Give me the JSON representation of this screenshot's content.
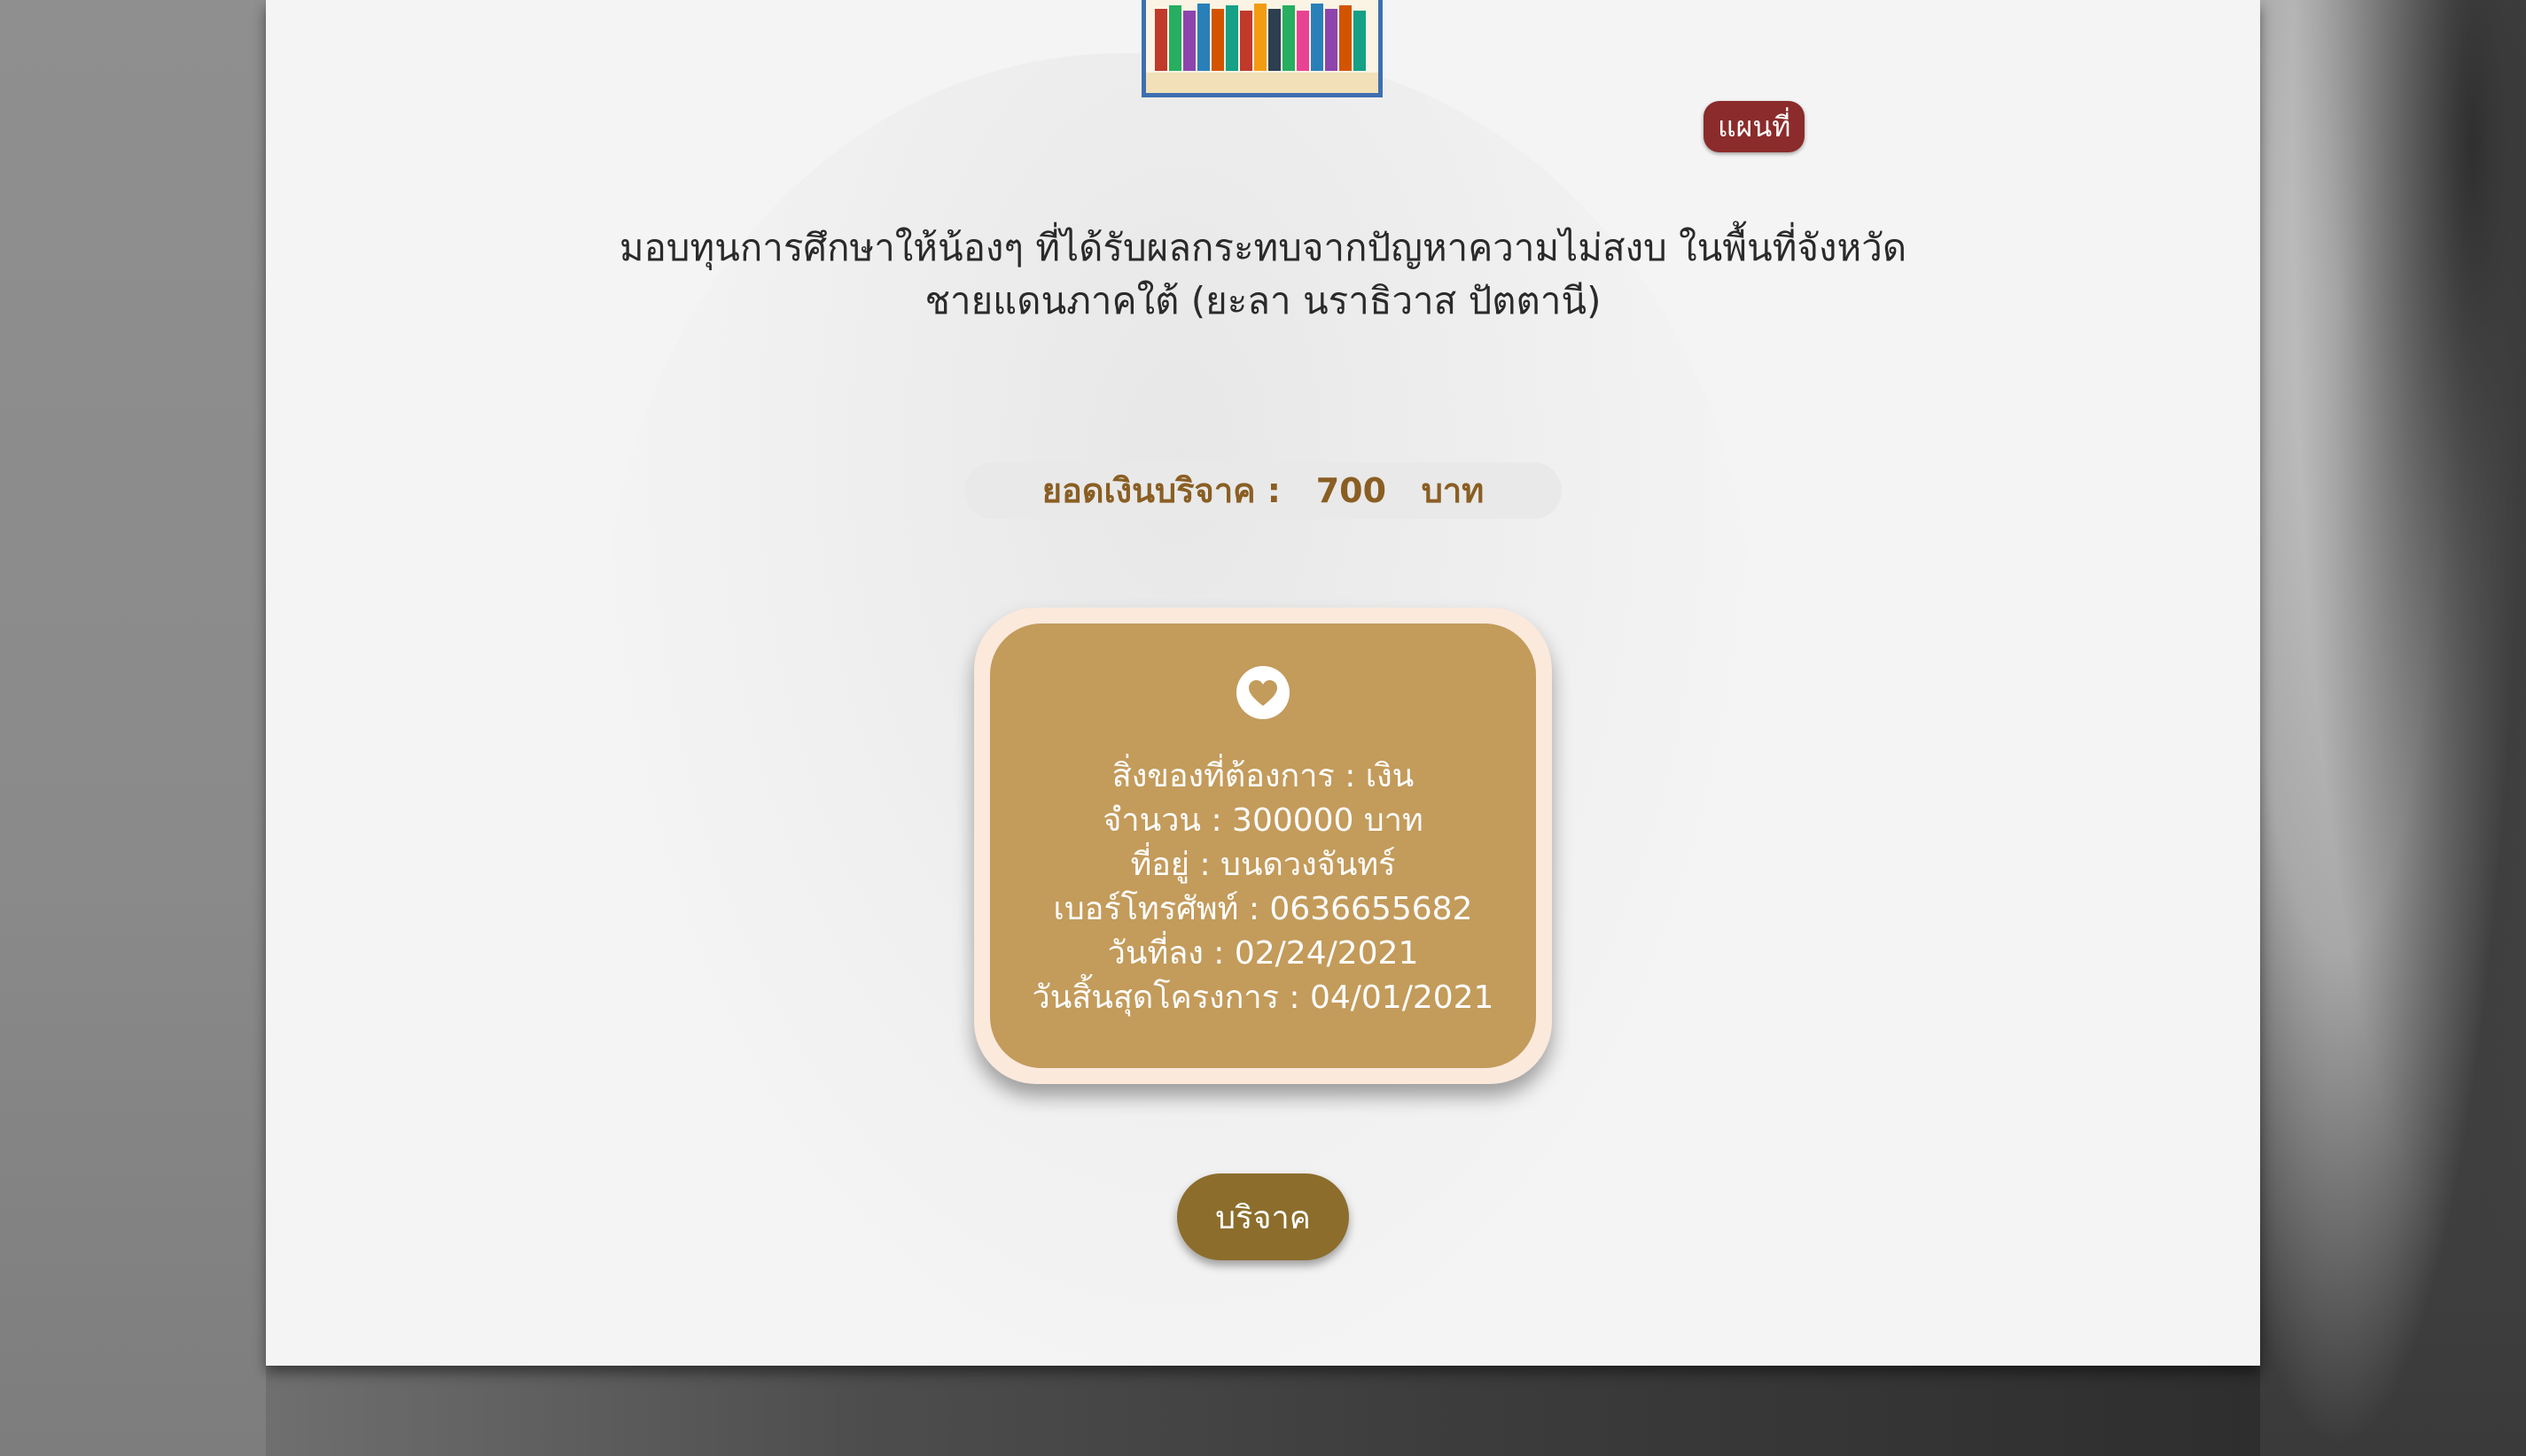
{
  "project": {
    "map_label": "แผนที่",
    "title_line1": "มอบทุนการศึกษาให้น้องๆ ที่ได้รับผลกระทบจากปัญหาความไม่สงบ ในพื้นที่จังหวัด",
    "title_line2": "ชายแดนภาคใต้ (ยะลา นราธิวาส ปัตตานี)",
    "total_label": "ยอดเงินบริจาค :",
    "total_value": "700",
    "total_unit": "บาท"
  },
  "details": {
    "icon": "heart-icon",
    "need": "สิ่งของที่ต้องการ : เงิน",
    "amount": "จำนวน : 300000 บาท",
    "address": "ที่อยู่ : บนดวงจันทร์",
    "phone": "เบอร์โทรศัพท์ : 0636655682",
    "posted": "วันที่ลง : 02/24/2021",
    "ends": "วันสิ้นสุดโครงการ : 04/01/2021"
  },
  "actions": {
    "donate_label": "บริจาค"
  },
  "colors": {
    "card": "#c39b5b",
    "card_border": "#fbe9dc",
    "badge": "#8b2b2b",
    "button": "#8c6d2c",
    "total_text": "#8a5e23"
  }
}
